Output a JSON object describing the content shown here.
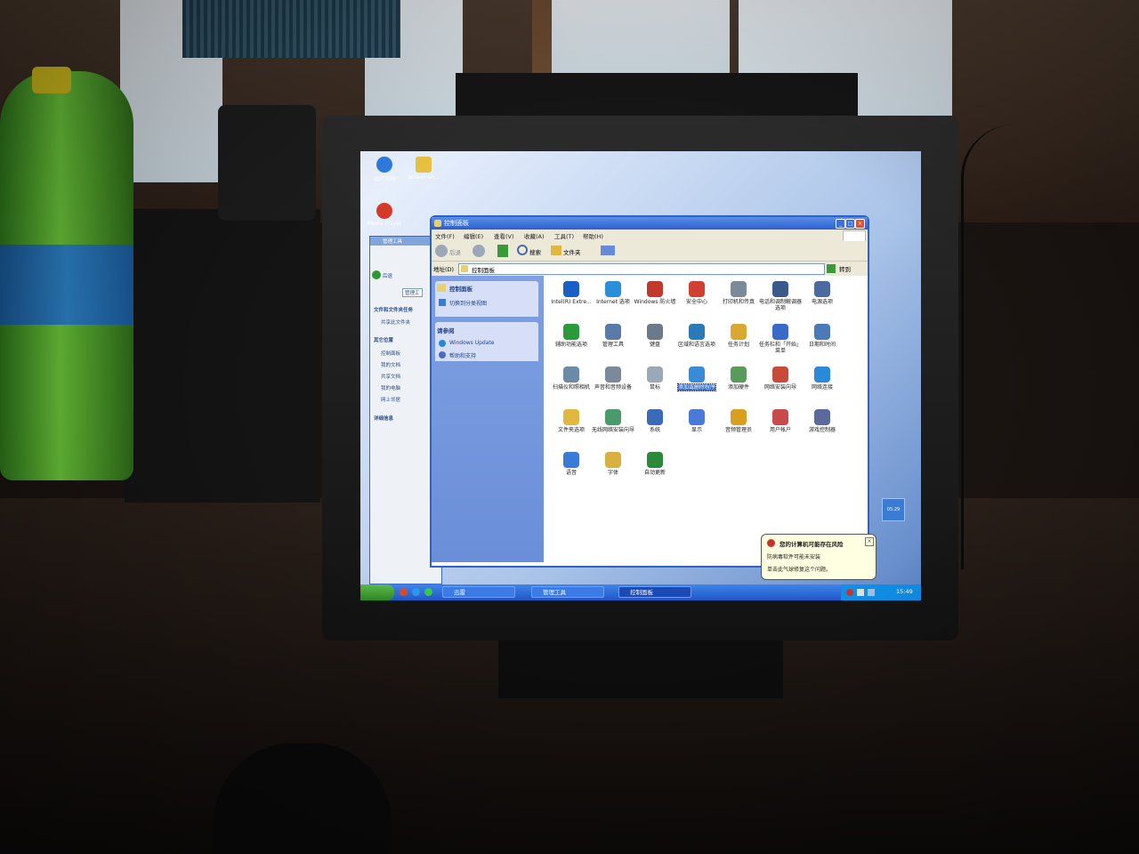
{
  "desktop": {
    "icons": [
      {
        "label": "我的文档",
        "icon": "network-places-icon",
        "color": "#2c7de0"
      },
      {
        "label": "Screen Sh...",
        "icon": "folder-icon",
        "color": "#e8c040"
      },
      {
        "label": "Media Player",
        "icon": "media-player-icon",
        "color": "#d43a2a"
      }
    ],
    "gadget_text": "05:29"
  },
  "bg_window": {
    "title": "管理工具",
    "address": "管理工",
    "back_label": "后退",
    "sections": [
      {
        "head": "文件和文件夹任务",
        "links": [
          "共享此文件夹"
        ]
      },
      {
        "head": "其它位置",
        "links": [
          "控制面板",
          "我的文档",
          "共享文档",
          "我的电脑",
          "网上邻居"
        ]
      },
      {
        "head": "详细信息",
        "links": []
      }
    ]
  },
  "cp_window": {
    "title": "控制面板",
    "menus": [
      "文件(F)",
      "编辑(E)",
      "查看(V)",
      "收藏(A)",
      "工具(T)",
      "帮助(H)"
    ],
    "toolbar": {
      "back": "后退",
      "search": "搜索",
      "folders": "文件夹"
    },
    "address_label": "地址(D)",
    "address_value": "控制面板",
    "go_label": "转到",
    "sidebar": [
      {
        "head": "控制面板",
        "links": [
          "切换到分类视图"
        ]
      },
      {
        "head": "请参阅",
        "links": [
          "Windows Update",
          "帮助和支持"
        ]
      }
    ],
    "items": [
      {
        "label": "Intel(R) Extre...",
        "color": "#1b5fc4"
      },
      {
        "label": "Internet 选项",
        "color": "#2b8ed8"
      },
      {
        "label": "Windows 防火墙",
        "color": "#c0392b"
      },
      {
        "label": "安全中心",
        "color": "#d04030"
      },
      {
        "label": "打印机和传真",
        "color": "#7a8a9a"
      },
      {
        "label": "电话和调制解调器选项",
        "color": "#3a5a8a"
      },
      {
        "label": "电源选项",
        "color": "#4a6aa0"
      },
      {
        "label": "辅助功能选项",
        "color": "#2a9a3a"
      },
      {
        "label": "管理工具",
        "color": "#5a7aa8"
      },
      {
        "label": "键盘",
        "color": "#6a7a8a"
      },
      {
        "label": "区域和语言选项",
        "color": "#2a7ab8"
      },
      {
        "label": "任务计划",
        "color": "#d8a830"
      },
      {
        "label": "任务栏和「开始」菜单",
        "color": "#3a6ac8"
      },
      {
        "label": "日期和时间",
        "color": "#4a7ab8"
      },
      {
        "label": "扫描仪和照相机",
        "color": "#6a8aa8"
      },
      {
        "label": "声音和音频设备",
        "color": "#7a8a9a"
      },
      {
        "label": "鼠标",
        "color": "#9aa8b8"
      },
      {
        "label": "添加或删除程序",
        "color": "#3a8ad8"
      },
      {
        "label": "添加硬件",
        "color": "#5a9a5a"
      },
      {
        "label": "网络安装向导",
        "color": "#c84a3a"
      },
      {
        "label": "网络连接",
        "color": "#2a8ad8"
      },
      {
        "label": "文件夹选项",
        "color": "#e0b840"
      },
      {
        "label": "无线网络安装向导",
        "color": "#4a9a6a"
      },
      {
        "label": "系统",
        "color": "#3a6ab8"
      },
      {
        "label": "显示",
        "color": "#4a7ad8"
      },
      {
        "label": "音频管理员",
        "color": "#d8a020"
      },
      {
        "label": "用户帐户",
        "color": "#c84a4a"
      },
      {
        "label": "游戏控制器",
        "color": "#5a6a9a"
      },
      {
        "label": "语音",
        "color": "#3a7ad8"
      },
      {
        "label": "字体",
        "color": "#d8b040"
      },
      {
        "label": "自动更新",
        "color": "#2a8a3a"
      }
    ],
    "selected_index": 17
  },
  "balloon": {
    "title": "您的计算机可能存在风险",
    "line1": "防病毒软件可能未安装",
    "line2": "单击此气球修复这个问题。"
  },
  "taskbar": {
    "buttons": [
      {
        "label": "迅雷"
      },
      {
        "label": "管理工具"
      },
      {
        "label": "控制面板"
      }
    ],
    "active_index": 2,
    "clock": "15:49"
  }
}
